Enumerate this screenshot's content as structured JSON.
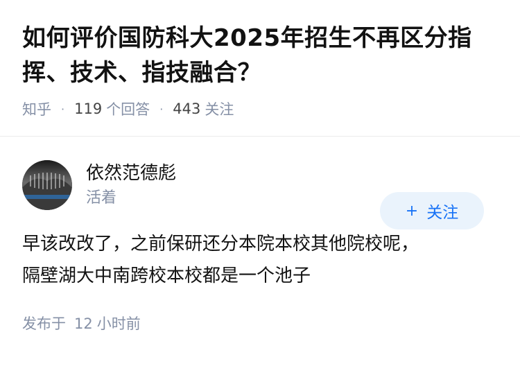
{
  "question": {
    "title": "如何评价国防科大2025年招生不再区分指挥、技术、指技融合？",
    "source": "知乎",
    "answers_count": "119",
    "answers_label": "个回答",
    "followers_count": "443",
    "followers_label": "关注"
  },
  "answer": {
    "author": {
      "name": "依然范德彪",
      "badge": "活着",
      "avatar_icon": "avatar-image"
    },
    "follow_button": {
      "icon": "plus-icon",
      "label": "关注"
    },
    "content_lines": [
      "早该改改了，之前保研还分本院本校其他院校呢，",
      "隔壁湖大中南跨校本校都是一个池子"
    ],
    "published_prefix": "发布于",
    "published_value": "12",
    "published_unit": "小时前"
  },
  "colors": {
    "primary": "#1772f6",
    "primary_bg": "#eaf3fc",
    "meta_text": "#8590a6",
    "title_text": "#121212"
  }
}
